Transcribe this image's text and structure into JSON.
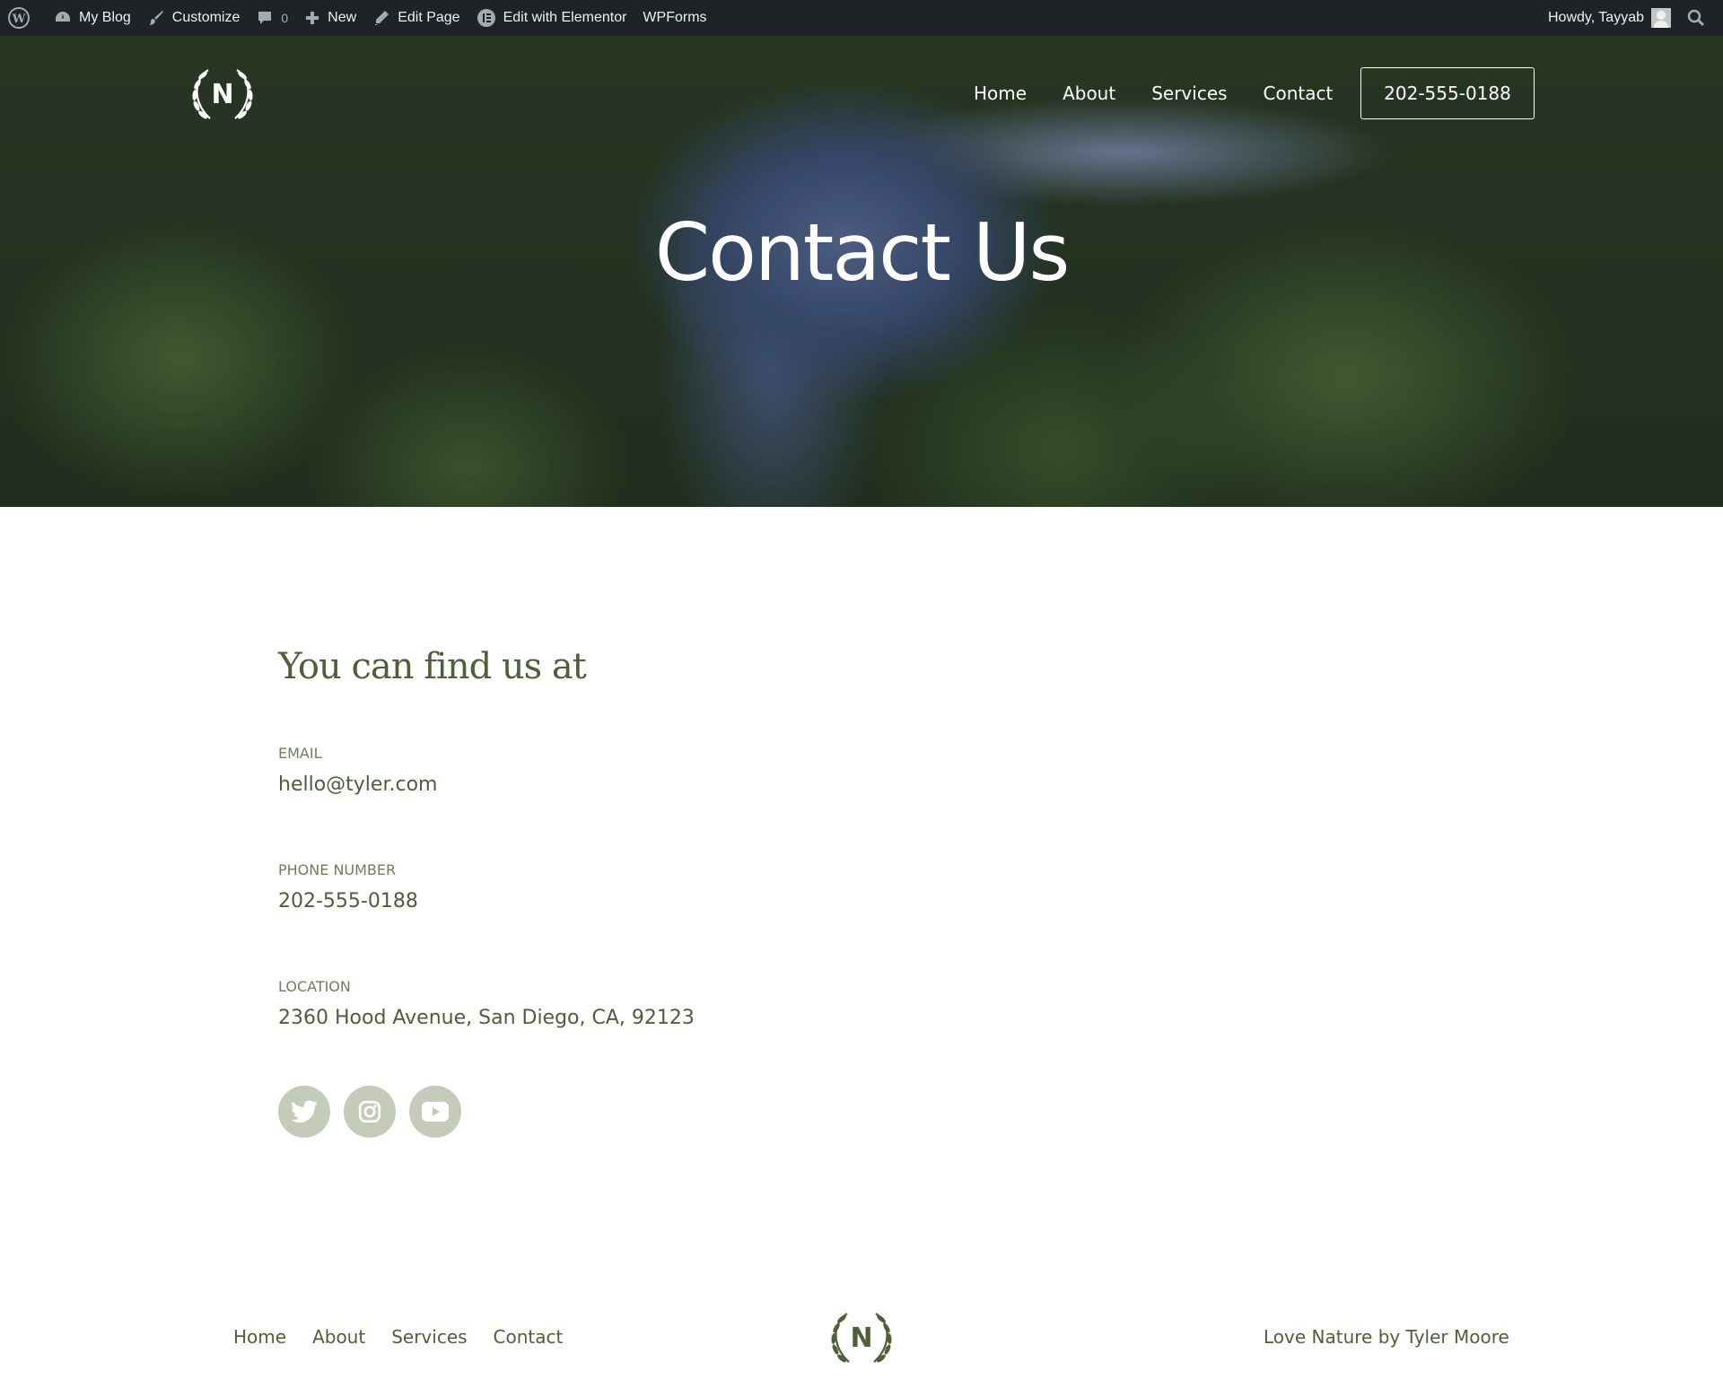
{
  "admin_bar": {
    "site": "My Blog",
    "customize": "Customize",
    "comments": "0",
    "new": "New",
    "edit_page": "Edit Page",
    "elementor": "Edit with Elementor",
    "wpforms": "WPForms",
    "howdy": "Howdy, Tayyab"
  },
  "header": {
    "logo_letter": "N",
    "nav": [
      "Home",
      "About",
      "Services",
      "Contact"
    ],
    "phone": "202-555-0188"
  },
  "hero": {
    "title": "Contact Us"
  },
  "contact": {
    "heading": "You can find us at",
    "email_label": "EMAIL",
    "email": "hello@tyler.com",
    "phone_label": "PHONE NUMBER",
    "phone": "202-555-0188",
    "location_label": "LOCATION",
    "location": "2360 Hood Avenue, San Diego, CA, 92123",
    "socials": [
      "twitter-icon",
      "instagram-icon",
      "youtube-icon"
    ]
  },
  "footer": {
    "nav": [
      "Home",
      "About",
      "Services",
      "Contact"
    ],
    "logo_letter": "N",
    "credit": "Love Nature by Tyler Moore"
  },
  "colors": {
    "admin_bar": "#1d2327",
    "accent_green": "#4f6038",
    "social_bg": "#c4cbb8"
  }
}
